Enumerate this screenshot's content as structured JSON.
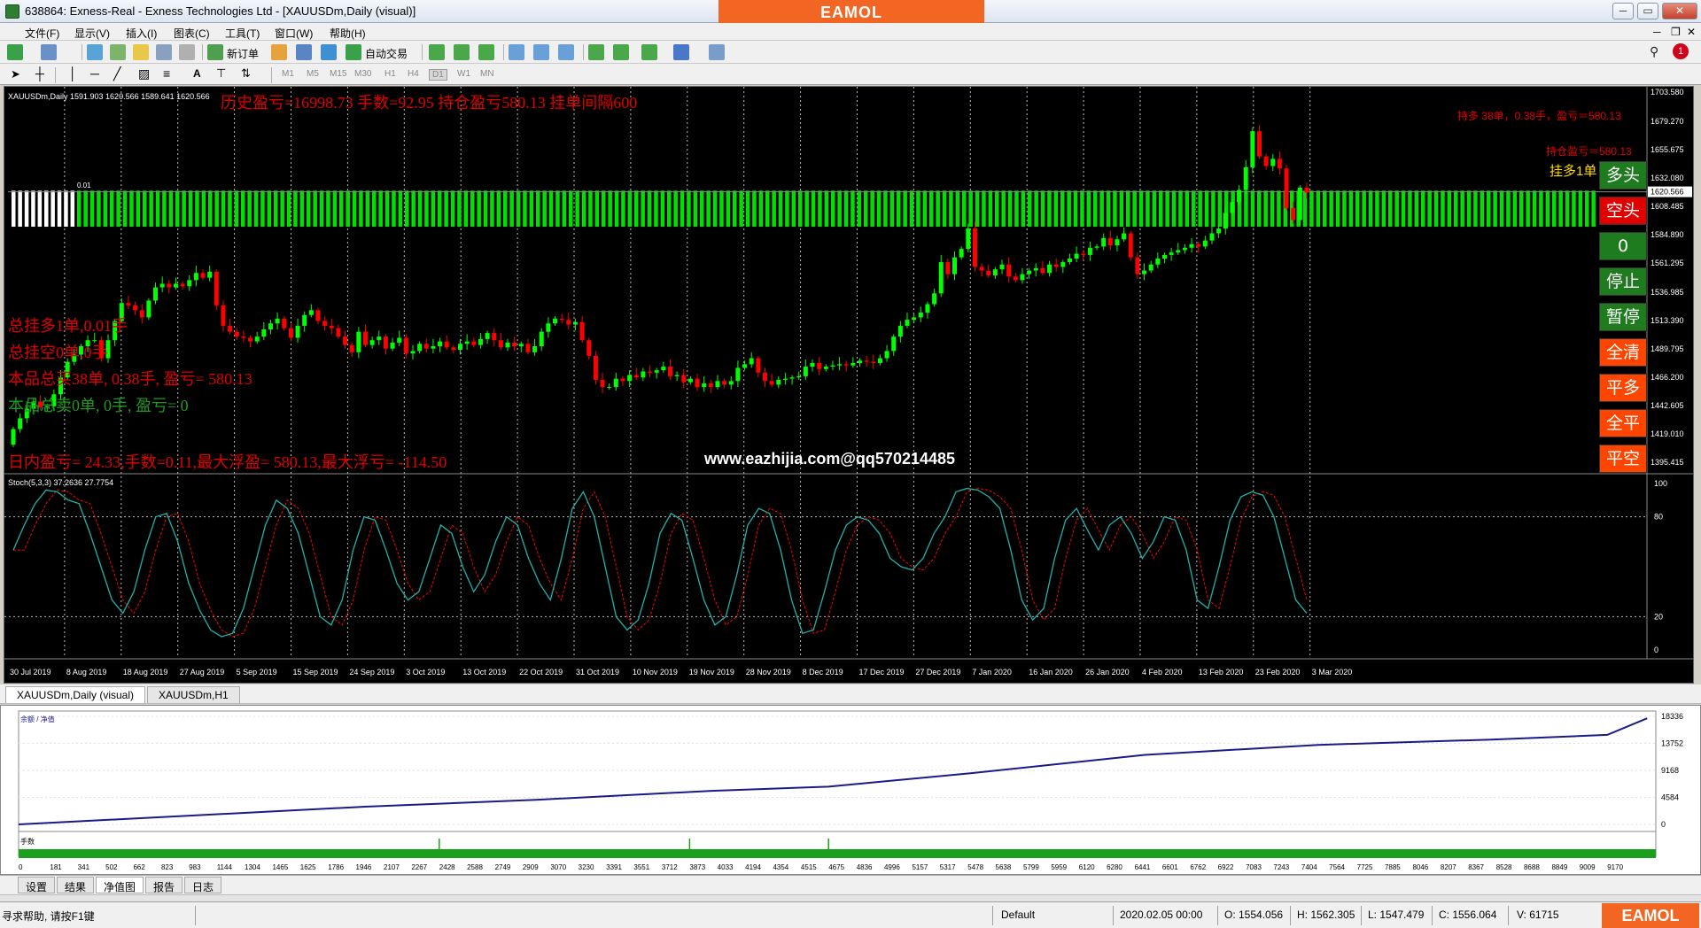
{
  "window": {
    "title": "638864: Exness-Real - Exness Technologies Ltd - [XAUUSDm,Daily (visual)]",
    "brand_logo": "EAMOL",
    "buttons": [
      "minimize",
      "restore",
      "close"
    ]
  },
  "menu": [
    "文件(F)",
    "显示(V)",
    "插入(I)",
    "图表(C)",
    "工具(T)",
    "窗口(W)",
    "帮助(H)"
  ],
  "toolbar": {
    "new_order_label": "新订单",
    "auto_trade_label": "自动交易",
    "timeframes": [
      "M1",
      "M5",
      "M15",
      "M30",
      "H1",
      "H4",
      "D1",
      "W1",
      "MN"
    ],
    "notification_count": "1"
  },
  "chart": {
    "symbol_info": "XAUUSDm,Daily  1591.903 1620.566 1589.641 1620.566",
    "history_stats": "历史盈亏=16998.73 手数=92.95 持仓盈亏580.13 挂单间隔600",
    "pending_lot_label": "0.01",
    "right_stats": {
      "long_summary": "持多 38单，0.38手，盈亏＝580.13",
      "position_pnl": "持仓盈亏＝580.13",
      "pending_long": "挂多1单"
    },
    "left_stats": [
      "总挂多1单,0.01手",
      "总挂空0单,0手",
      "本品总买38单, 0.38手, 盈亏= 580.13",
      "本品总卖0单, 0手, 盈亏= 0",
      "日内盈亏= 24.33,手数=0.11,最大浮盈= 580.13,最大浮亏= -114.50"
    ],
    "watermark": "www.eazhijia.com@qq570214485",
    "price_axis": [
      "1703.580",
      "1679.270",
      "1655.675",
      "1632.080",
      "1620.566",
      "1608.485",
      "1584.890",
      "1561.295",
      "1536.985",
      "1513.390",
      "1489.795",
      "1466.200",
      "1442.605",
      "1419.010",
      "1395.415"
    ],
    "current_price": "1620.566",
    "stoch_label": "Stoch(5,3,3) 37.2636 27.7754",
    "stoch_axis": [
      "100",
      "80",
      "20",
      "0"
    ],
    "date_axis": [
      "30 Jul 2019",
      "8 Aug 2019",
      "18 Aug 2019",
      "27 Aug 2019",
      "5 Sep 2019",
      "15 Sep 2019",
      "24 Sep 2019",
      "3 Oct 2019",
      "13 Oct 2019",
      "22 Oct 2019",
      "31 Oct 2019",
      "10 Nov 2019",
      "19 Nov 2019",
      "28 Nov 2019",
      "8 Dec 2019",
      "17 Dec 2019",
      "27 Dec 2019",
      "7 Jan 2020",
      "16 Jan 2020",
      "26 Jan 2020",
      "4 Feb 2020",
      "13 Feb 2020",
      "23 Feb 2020",
      "3 Mar 2020"
    ],
    "control_buttons": [
      {
        "label": "多头",
        "color": "#1e7b1e"
      },
      {
        "label": "空头",
        "color": "#e00000"
      },
      {
        "label": "0",
        "color": "#1e7b1e"
      },
      {
        "label": "停止",
        "color": "#1e7b1e"
      },
      {
        "label": "暂停",
        "color": "#1e7b1e"
      },
      {
        "label": "全清",
        "color": "#ff4500"
      },
      {
        "label": "平多",
        "color": "#ff4500"
      },
      {
        "label": "全平",
        "color": "#ff4500"
      },
      {
        "label": "平空",
        "color": "#ff4500"
      }
    ],
    "colors": {
      "bull": "#00ff00",
      "bear": "#ff0000",
      "stoch_main": "#20b2aa",
      "stoch_signal": "#ff0000",
      "grid_band": "#00e000"
    }
  },
  "chart_tabs": [
    "XAUUSDm,Daily (visual)",
    "XAUUSDm,H1"
  ],
  "equity": {
    "legend": "余额 / 净值",
    "y_axis": [
      "18336",
      "13752",
      "9168",
      "4584",
      "0"
    ],
    "lots_label": "手数",
    "x_axis": [
      "0",
      "181",
      "341",
      "502",
      "662",
      "823",
      "983",
      "1144",
      "1304",
      "1465",
      "1625",
      "1786",
      "1946",
      "2107",
      "2267",
      "2428",
      "2588",
      "2749",
      "2909",
      "3070",
      "3230",
      "3391",
      "3551",
      "3712",
      "3873",
      "4033",
      "4194",
      "4354",
      "4515",
      "4675",
      "4836",
      "4996",
      "5157",
      "5317",
      "5478",
      "5638",
      "5799",
      "5959",
      "6120",
      "6280",
      "6441",
      "6601",
      "6762",
      "6922",
      "7083",
      "7243",
      "7404",
      "7564",
      "7725",
      "7885",
      "8046",
      "8207",
      "8367",
      "8528",
      "8688",
      "8849",
      "9009",
      "9170"
    ]
  },
  "chart_data": {
    "type": "line",
    "title": "",
    "xlabel": "",
    "ylabel": "",
    "ylim": [
      0,
      18336
    ],
    "x": [
      0,
      1000,
      2000,
      3000,
      4000,
      4675,
      5500,
      6500,
      7500,
      8500,
      9170,
      9400
    ],
    "series": [
      {
        "name": "余额 / 净值",
        "values": [
          0,
          1500,
          3000,
          4200,
          5700,
          6400,
          8700,
          11800,
          13500,
          14400,
          15200,
          18000
        ]
      }
    ]
  },
  "bottom_tabs": [
    "设置",
    "结果",
    "净值图",
    "报告",
    "日志"
  ],
  "status": {
    "help": "寻求帮助, 请按F1键",
    "profile": "Default",
    "datetime": "2020.02.05 00:00",
    "open": "O: 1554.056",
    "high": "H: 1562.305",
    "low": "L: 1547.479",
    "close": "C: 1556.064",
    "volume": "V: 61715"
  }
}
